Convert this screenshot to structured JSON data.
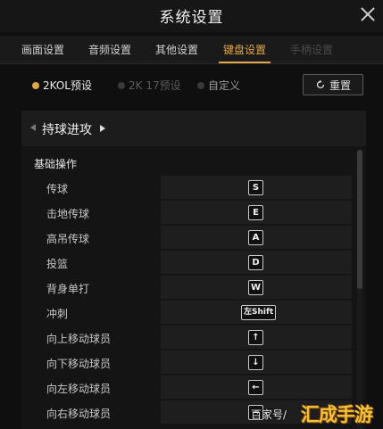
{
  "window": {
    "title": "系统设置"
  },
  "tabs": [
    {
      "label": "画面设置",
      "state": "normal"
    },
    {
      "label": "音频设置",
      "state": "normal"
    },
    {
      "label": "其他设置",
      "state": "normal"
    },
    {
      "label": "键盘设置",
      "state": "active"
    },
    {
      "label": "手柄设置",
      "state": "disabled"
    }
  ],
  "presets": [
    {
      "label": "2KOL预设",
      "selected": true
    },
    {
      "label": "2K 17预设",
      "selected": false
    },
    {
      "label": "自定义",
      "selected": false
    }
  ],
  "reset_label": "重置",
  "panel": {
    "title": "持球进攻",
    "section": "基础操作",
    "rows": [
      {
        "label": "传球",
        "key": "S"
      },
      {
        "label": "击地传球",
        "key": "E"
      },
      {
        "label": "高吊传球",
        "key": "A"
      },
      {
        "label": "投篮",
        "key": "D"
      },
      {
        "label": "背身单打",
        "key": "W"
      },
      {
        "label": "冲刺",
        "key": "左Shift"
      },
      {
        "label": "向上移动球员",
        "key": "↑"
      },
      {
        "label": "向下移动球员",
        "key": "↓"
      },
      {
        "label": "向左移动球员",
        "key": "←"
      },
      {
        "label": "向右移动球员",
        "key": "→"
      }
    ]
  },
  "watermark": {
    "text": "百家号/",
    "logo": "汇成手游"
  },
  "colors": {
    "accent": "#e0a64a",
    "background": "#0f0f10",
    "panel": "#141415"
  }
}
